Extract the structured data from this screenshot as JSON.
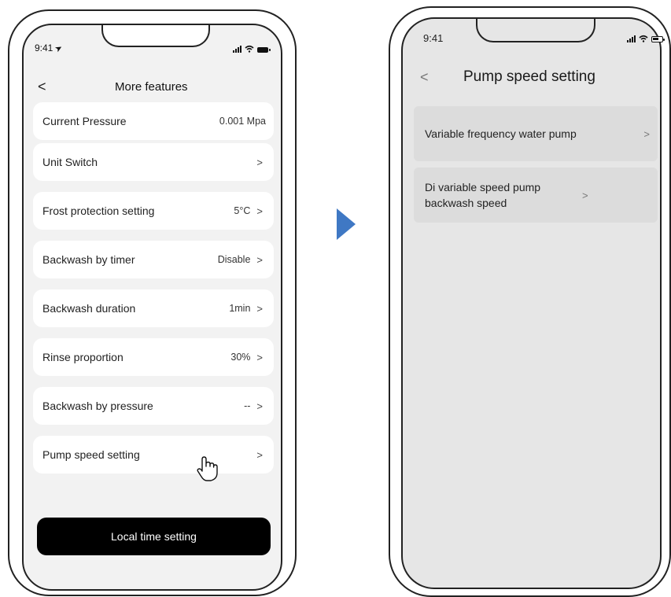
{
  "left_screen": {
    "status_time": "9:41",
    "back_glyph": "<",
    "title": "More features",
    "items": [
      {
        "label": "Current Pressure",
        "value": "0.001 Mpa",
        "chevron": ""
      },
      {
        "label": "Unit Switch",
        "value": "",
        "chevron": ">"
      },
      {
        "label": "Frost protection setting",
        "value": "5°C",
        "chevron": ">"
      },
      {
        "label": "Backwash by timer",
        "value": "Disable",
        "chevron": ">"
      },
      {
        "label": "Backwash duration",
        "value": "1min",
        "chevron": ">"
      },
      {
        "label": "Rinse proportion",
        "value": "30%",
        "chevron": ">"
      },
      {
        "label": "Backwash by pressure",
        "value": "--",
        "chevron": ">"
      },
      {
        "label": "Pump speed setting",
        "value": "",
        "chevron": ">"
      }
    ],
    "button_label": "Local time setting",
    "pointer_icon": "hand-pointer-icon"
  },
  "transition_icon": "play-arrow-icon",
  "transition_color": "#3f78c4",
  "right_screen": {
    "status_time": "9:41",
    "back_glyph": "<",
    "title": "Pump speed setting",
    "items": [
      {
        "label": "Variable frequency water pump",
        "chevron": ">"
      },
      {
        "label": "Di variable speed pump backwash speed",
        "chevron": ">"
      }
    ]
  },
  "colors": {
    "left_background": "#f2f2f2",
    "right_background": "#e6e6e6",
    "button": "#000000"
  }
}
